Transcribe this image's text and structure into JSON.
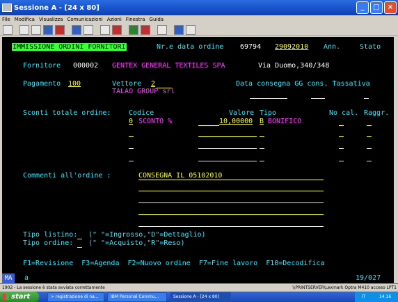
{
  "window": {
    "title": "Sessione A - [24 x 80]",
    "min": "_",
    "max": "□",
    "close": "×"
  },
  "menu": [
    "File",
    "Modifica",
    "Visualizza",
    "Comunicazioni",
    "Azioni",
    "Finestra",
    "Guida"
  ],
  "screen": {
    "title": "IMMISSIONE ORDINI FORNITORI",
    "nr_data_label": "Nr.e data ordine",
    "order_number": "69794",
    "order_date": "29092010",
    "ann_label": "Ann.",
    "stato_label": "Stato",
    "fornitore_label": "Fornitore",
    "fornitore_code": "000002",
    "fornitore_name": "GENTEX GENERAL TEXTILES SPA",
    "fornitore_address": "Via Duomo,340/348",
    "pagamento_label": "Pagamento",
    "pagamento_value": "100",
    "vettore_label": "Vettore",
    "vettore_value": "2",
    "vettore_name": "TALAO GROUP srl",
    "data_consegna_label": "Data consegna GG cons. Tassativa",
    "sconti_label": "Sconti totale ordine:",
    "col_codice": "Codice",
    "col_valore": "Valore",
    "col_tipo": "Tipo",
    "col_nocal": "No cal.",
    "col_raggr": "Raggr.",
    "sconto_code": "0",
    "sconto_desc": "SCONTO %",
    "sconto_value": "10,00000",
    "sconto_tipo": "B",
    "sconto_tipo_desc": "BONIFICO",
    "commenti_label": "Commenti all'ordine :",
    "commento_1": "CONSEGNA IL 05102010",
    "tipo_listino_label": "Tipo listino:",
    "tipo_listino_hint": "(\" \"=Ingrosso,\"D\"=Dettaglio)",
    "tipo_ordine_label": "Tipo ordine:",
    "tipo_ordine_hint": "(\" \"=Acquisto,\"R\"=Reso)",
    "fkeys": "F1=Revisione  F3=Agenda  F2=Nuovo ordine  F7=Fine lavoro  F10=Decodifica"
  },
  "oia": {
    "mode": "MA",
    "session": "a",
    "cursor": "19/027"
  },
  "status": {
    "message": "1902 - La sessione è stata avviata correttamente",
    "printer": "\\\\PRINTSERVER\\Lexmark Optra M410 acceso LPT1"
  },
  "taskbar": {
    "start": "start",
    "tasks": [
      "> registrazione di na...",
      "IBM Personal Commu...",
      "Sessione A - [24 x 80]"
    ],
    "lang": "IT",
    "clock": "14.16"
  }
}
